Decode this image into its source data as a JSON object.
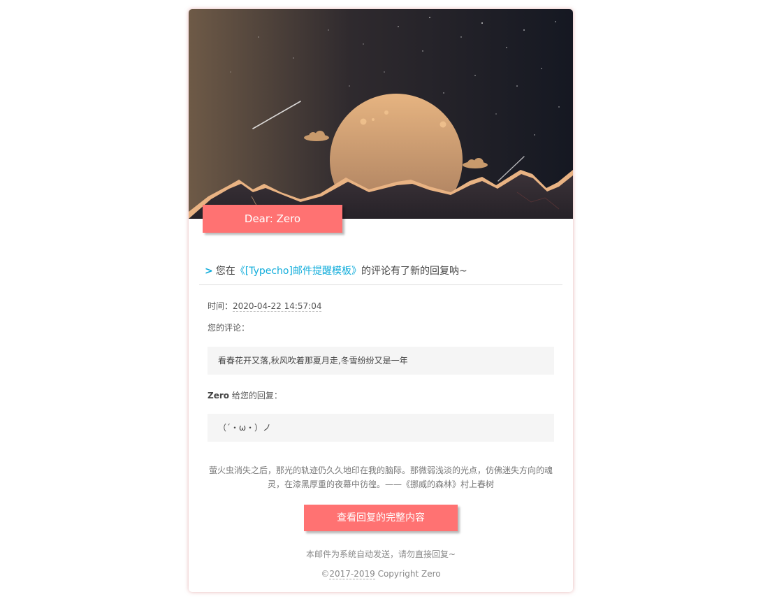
{
  "header": {
    "greeting": "Dear: Zero"
  },
  "headline": {
    "arrow": ">",
    "prefix": "您在",
    "post_link": "《[Typecho]邮件提醒模板》",
    "suffix": "的评论有了新的回复呐~"
  },
  "details": {
    "time_label": "时间：",
    "time_value": "2020-04-22 14:57:04",
    "comment_label": "您的评论：",
    "comment_text": "看春花开又落,秋风吹着那夏月走,冬雪纷纷又是一年",
    "replier_name": "Zero",
    "reply_label": " 给您的回复：",
    "reply_text": "（´・ω・）ノ"
  },
  "quote": {
    "line1": "萤火虫消失之后，那光的轨迹仍久久地印在我的脑际。那微弱浅淡的光点，仿佛迷失方向的魂",
    "line2": "灵，在漆黑厚重的夜幕中彷徨。——《挪威的森林》村上春树"
  },
  "cta": {
    "label": "查看回复的完整内容"
  },
  "footer": {
    "auto_notice": "本邮件为系统自动发送，请勿直接回复~",
    "copyright_prefix": "©",
    "copyright_years": "2017-2019",
    "copyright_suffix": " Copyright Zero"
  },
  "colors": {
    "accent": "#ff7272",
    "link": "#12addb",
    "quote_bg": "#f5f5f5"
  }
}
